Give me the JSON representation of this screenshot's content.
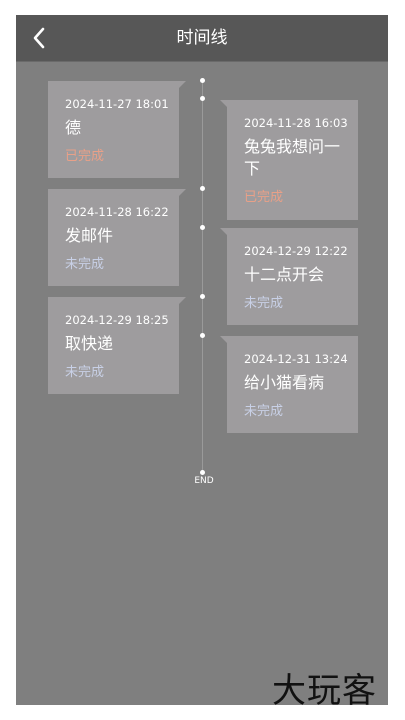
{
  "header": {
    "title": "时间线",
    "back_icon": "chevron-left-icon"
  },
  "timeline": {
    "end_label": "END",
    "items": [
      {
        "time": "2024-11-27 18:01",
        "task": "德",
        "status": "已完成",
        "state": "done"
      },
      {
        "time": "2024-11-28 16:03",
        "task": "兔兔我想问一下",
        "status": "已完成",
        "state": "done"
      },
      {
        "time": "2024-11-28 16:22",
        "task": "发邮件",
        "status": "未完成",
        "state": "pending"
      },
      {
        "time": "2024-12-29 12:22",
        "task": "十二点开会",
        "status": "未完成",
        "state": "pending"
      },
      {
        "time": "2024-12-29 18:25",
        "task": "取快递",
        "status": "未完成",
        "state": "pending"
      },
      {
        "time": "2024-12-31 13:24",
        "task": "给小猫看病",
        "status": "未完成",
        "state": "pending"
      }
    ]
  },
  "colors": {
    "background": "#7f7f7f",
    "header": "#575757",
    "card": "#9e9c9e",
    "done": "#e8a088",
    "pending": "#c8d0e6"
  },
  "watermark": "大玩客"
}
